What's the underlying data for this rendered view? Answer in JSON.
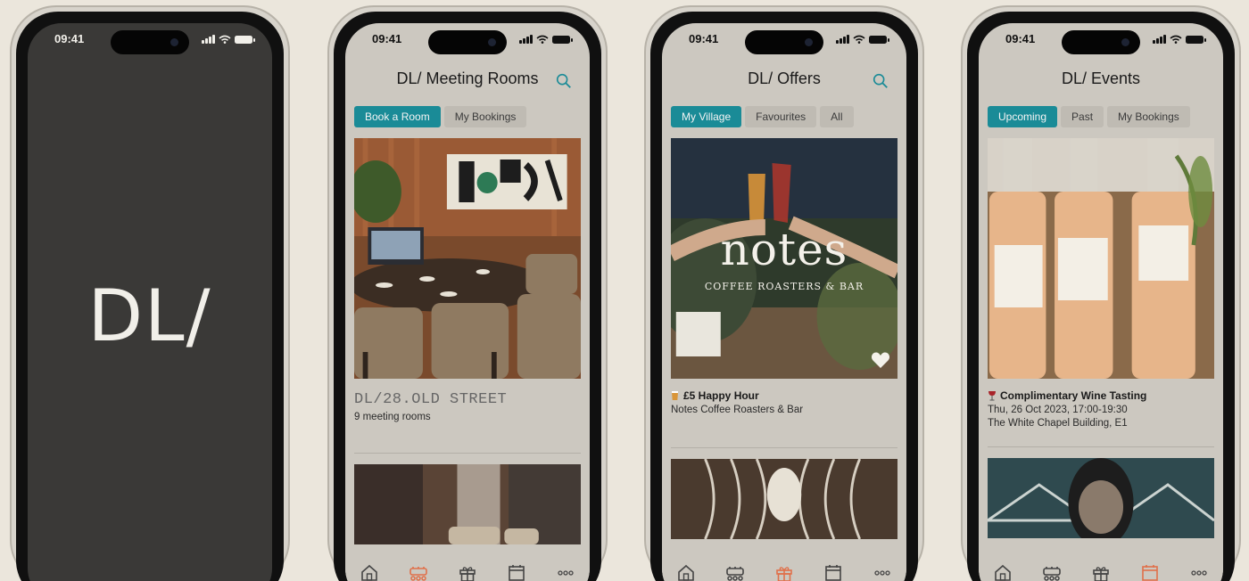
{
  "status_time": "09:41",
  "splash": {
    "logo": "DL/"
  },
  "meeting_rooms": {
    "title": "DL/ Meeting Rooms",
    "tabs": [
      {
        "label": "Book a Room",
        "active": true
      },
      {
        "label": "My Bookings",
        "active": false
      }
    ],
    "cards": [
      {
        "title": "DL/28.OLD STREET",
        "subtitle": "9 meeting rooms"
      }
    ]
  },
  "offers": {
    "title": "DL/ Offers",
    "tabs": [
      {
        "label": "My Village",
        "active": true
      },
      {
        "label": "Favourites",
        "active": false
      },
      {
        "label": "All",
        "active": false
      }
    ],
    "cards": [
      {
        "brand": "notes",
        "brand_tagline": "COFFEE ROASTERS & BAR",
        "title": "£5 Happy Hour",
        "subtitle": "Notes Coffee Roasters & Bar"
      }
    ]
  },
  "events": {
    "title": "DL/ Events",
    "tabs": [
      {
        "label": "Upcoming",
        "active": true
      },
      {
        "label": "Past",
        "active": false
      },
      {
        "label": "My Bookings",
        "active": false
      }
    ],
    "cards": [
      {
        "title": "Complimentary Wine Tasting",
        "date": "Thu, 26 Oct 2023, 17:00-19:30",
        "venue": "The White Chapel Building, E1"
      }
    ]
  },
  "nav_icons": [
    "home-icon",
    "meeting-room-icon",
    "gift-icon",
    "calendar-icon",
    "more-icon"
  ],
  "colors": {
    "accent": "#1a8b97",
    "nav_active": "#e0704a",
    "nav_inactive": "#444444"
  }
}
